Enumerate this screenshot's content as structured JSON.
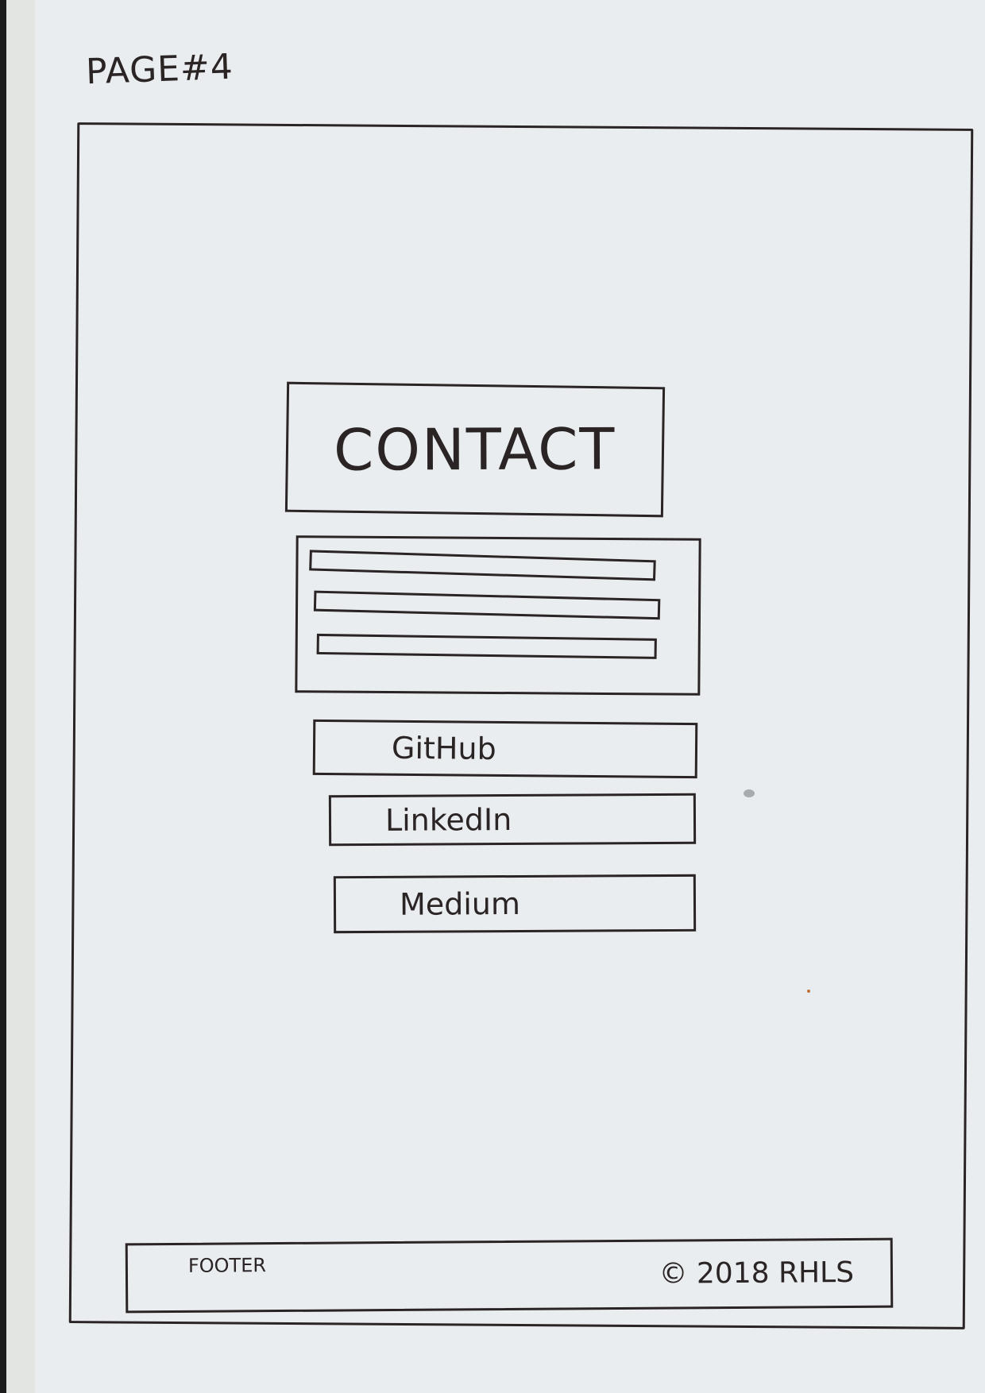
{
  "page_label": "PAGE#4",
  "header": {
    "title": "CONTACT"
  },
  "contact_form": {
    "fields": [
      {
        "name": "field-1"
      },
      {
        "name": "field-2"
      },
      {
        "name": "field-3"
      }
    ]
  },
  "links": {
    "github": "GitHub",
    "linkedin": "LinkedIn",
    "medium": "Medium"
  },
  "footer": {
    "label": "FOOTER",
    "copyright": "© 2018 RHLS"
  },
  "colors": {
    "ink": "#2a2424",
    "paper": "#eaedf0"
  }
}
